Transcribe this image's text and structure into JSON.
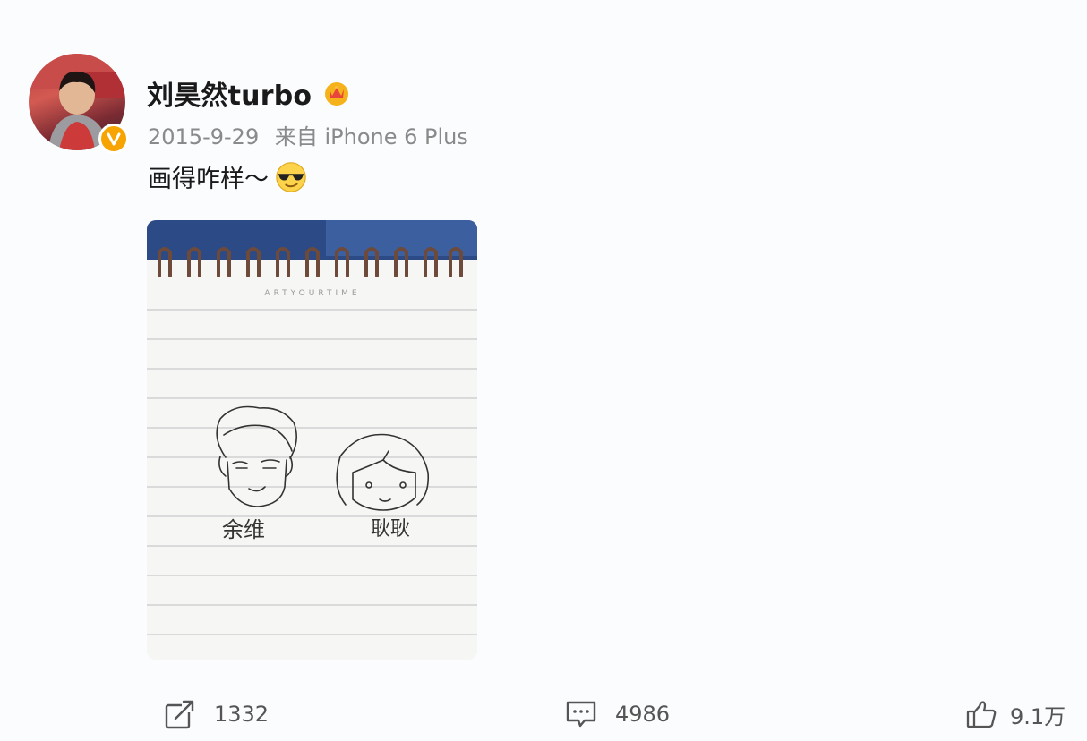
{
  "post": {
    "username": "刘昊然turbo",
    "timestamp": "2015-9-29",
    "source": "来自 iPhone 6 Plus",
    "text": "画得咋样～",
    "emoji": "sunglasses-emoji",
    "badge": "verified-v-badge",
    "member_icon": "crown-icon"
  },
  "image": {
    "notebook_brand": "ARTYOURTIME",
    "left_caption": "余维",
    "right_caption": "耿耿"
  },
  "stats": {
    "reposts": "1332",
    "comments": "4986",
    "likes": "9.1万"
  },
  "colors": {
    "background": "#fbfcfe",
    "badge": "#f7a400",
    "meta_text": "#8a8a8a",
    "icon": "#555555"
  }
}
